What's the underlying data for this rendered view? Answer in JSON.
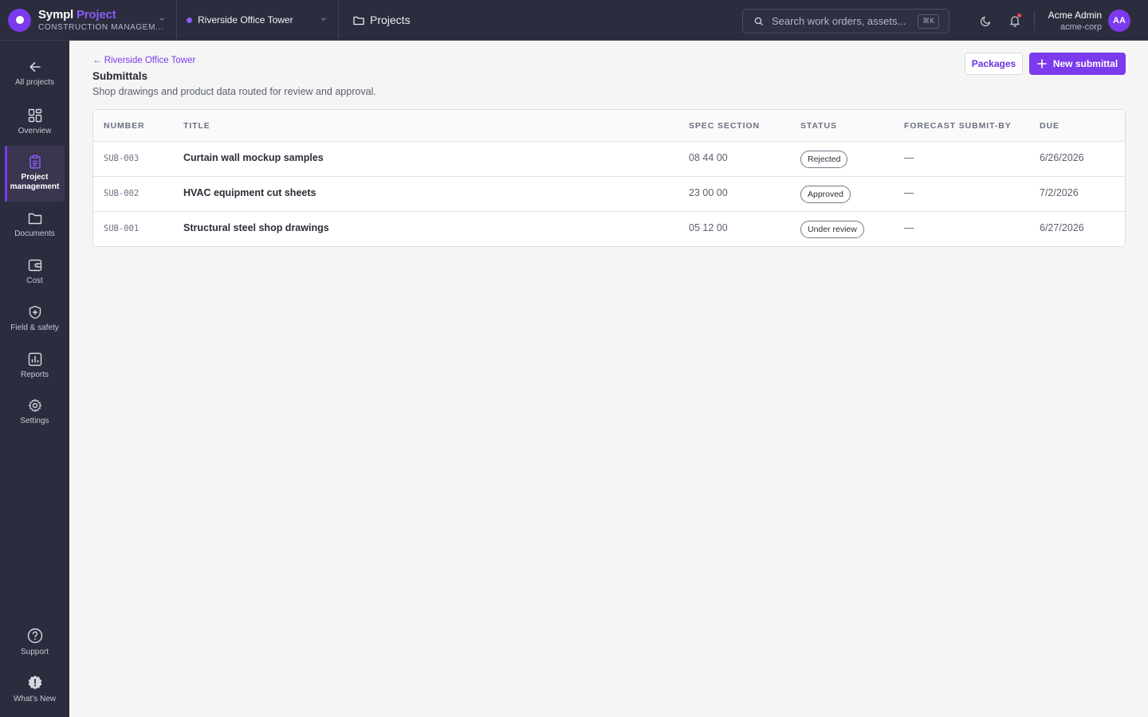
{
  "brand": {
    "name_primary": "Sympl",
    "name_accent": "Project",
    "subtitle": "CONSTRUCTION MANAGEM..."
  },
  "project_selector": {
    "label": "Riverside Office Tower"
  },
  "header_breadcrumb": {
    "label": "Projects"
  },
  "search": {
    "placeholder": "Search work orders, assets...",
    "shortcut": "⌘K"
  },
  "user": {
    "name": "Acme Admin",
    "org": "acme-corp",
    "initials": "AA"
  },
  "sidebar": {
    "items": [
      {
        "label": "All projects",
        "icon": "arrow-left-icon"
      },
      {
        "label": "Overview",
        "icon": "grid-icon"
      },
      {
        "label": "Project management",
        "icon": "clipboard-icon",
        "active": true
      },
      {
        "label": "Documents",
        "icon": "folder-icon"
      },
      {
        "label": "Cost",
        "icon": "wallet-icon"
      },
      {
        "label": "Field & safety",
        "icon": "shield-plus-icon"
      },
      {
        "label": "Reports",
        "icon": "bar-chart-icon"
      },
      {
        "label": "Settings",
        "icon": "gear-icon"
      }
    ],
    "bottom_items": [
      {
        "label": "Support",
        "icon": "help-circle-icon"
      },
      {
        "label": "What's New",
        "icon": "badge-alert-icon"
      }
    ]
  },
  "page": {
    "back_link": "← Riverside Office Tower",
    "title": "Submittals",
    "description": "Shop drawings and product data routed for review and approval.",
    "packages_button": "Packages",
    "new_button": "New submittal"
  },
  "table": {
    "columns": [
      "NUMBER",
      "TITLE",
      "SPEC SECTION",
      "STATUS",
      "FORECAST SUBMIT-BY",
      "DUE"
    ],
    "rows": [
      {
        "number": "SUB-003",
        "title": "Curtain wall mockup samples",
        "spec": "08 44 00",
        "status": "Rejected",
        "forecast": "—",
        "due": "6/26/2026"
      },
      {
        "number": "SUB-002",
        "title": "HVAC equipment cut sheets",
        "spec": "23 00 00",
        "status": "Approved",
        "forecast": "—",
        "due": "7/2/2026"
      },
      {
        "number": "SUB-001",
        "title": "Structural steel shop drawings",
        "spec": "05 12 00",
        "status": "Under review",
        "forecast": "—",
        "due": "6/27/2026"
      }
    ]
  },
  "colors": {
    "accent": "#7c3aed",
    "chrome": "#2b2d3e",
    "background": "#f5f5f5"
  }
}
